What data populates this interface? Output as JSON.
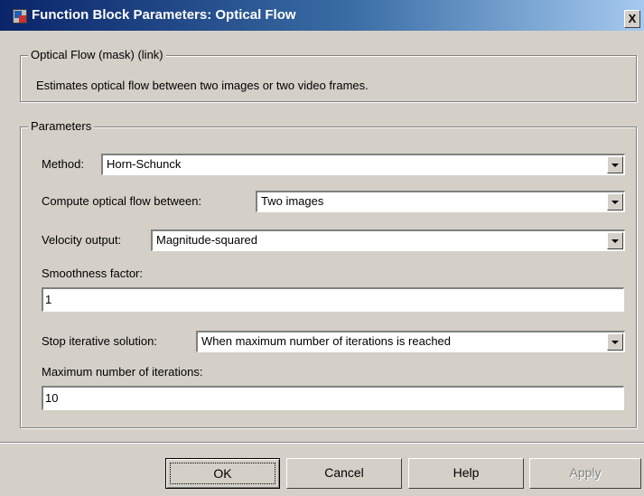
{
  "window": {
    "title": "Function Block Parameters: Optical Flow",
    "close_label": "X"
  },
  "description_group": {
    "legend": "Optical Flow (mask) (link)",
    "text": "Estimates optical flow between two images or two video frames."
  },
  "parameters_group": {
    "legend": "Parameters",
    "method": {
      "label": "Method:",
      "value": "Horn-Schunck"
    },
    "compute_between": {
      "label": "Compute optical flow between:",
      "value": "Two images"
    },
    "velocity_output": {
      "label": "Velocity output:",
      "value": "Magnitude-squared"
    },
    "smoothness": {
      "label": "Smoothness factor:",
      "value": "1"
    },
    "stop_solution": {
      "label": "Stop iterative solution:",
      "value": "When maximum number of iterations is reached"
    },
    "max_iterations": {
      "label": "Maximum number of iterations:",
      "value": "10"
    }
  },
  "buttons": {
    "ok": "OK",
    "cancel": "Cancel",
    "help": "Help",
    "apply": "Apply"
  }
}
